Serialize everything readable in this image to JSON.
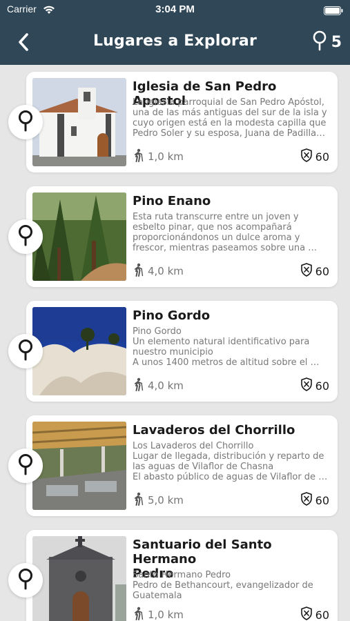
{
  "status_bar": {
    "carrier": "Carrier",
    "time": "3:04 PM"
  },
  "nav": {
    "title": "Lugares a Explorar",
    "back_icon": "chevron-left-icon",
    "counter_icon": "map-pin-icon",
    "count": "5"
  },
  "colors": {
    "header": "#2f4756",
    "background": "#e6e6e6",
    "card": "#ffffff",
    "muted_text": "#787878"
  },
  "places": [
    {
      "title_lines": [
        "Iglesia de San Pedro Apostol"
      ],
      "description_lines": [
        "La iglesia parroquial de San Pedro Apóstol,",
        "una de las más antiguas del sur de la isla y",
        "cuyo origen está en la modesta capilla que",
        "Pedro Soler y su esposa, Juana de Padilla…"
      ],
      "distance": "1,0 km",
      "points": "60",
      "image": "church-photo"
    },
    {
      "title_lines": [
        "Pino Enano"
      ],
      "description_lines": [
        "Esta ruta transcurre entre un joven y",
        "esbelto pinar, que nos acompañará",
        "proporcionándonos un dulce aroma y",
        "frescor, mientras paseamos sobre una …"
      ],
      "distance": "4,0 km",
      "points": "60",
      "image": "pine-forest-photo"
    },
    {
      "title_lines": [
        "Pino Gordo"
      ],
      "description_lines": [
        "Pino Gordo",
        "Un elemento natural identificativo para",
        "nuestro municipio",
        "A unos 1400 metros de altitud sobre el …"
      ],
      "distance": "4,0 km",
      "points": "60",
      "image": "rock-landscape-photo"
    },
    {
      "title_lines": [
        "Lavaderos del Chorrillo"
      ],
      "description_lines": [
        "Los Lavaderos del Chorrillo",
        "Lugar de llegada, distribución y reparto de",
        "las aguas de Vilaflor de Chasna",
        "El abasto público de aguas de Vilaflor de …"
      ],
      "distance": "5,0 km",
      "points": "60",
      "image": "wash-house-photo"
    },
    {
      "title_lines": [
        "Santuario del Santo Hermano",
        "Pedro"
      ],
      "description_lines": [
        "Santo Hermano Pedro",
        "Pedro de Bethancourt, evangelizador de",
        "Guatemala"
      ],
      "distance": "1,0 km",
      "points": "60",
      "image": "sanctuary-photo"
    }
  ]
}
